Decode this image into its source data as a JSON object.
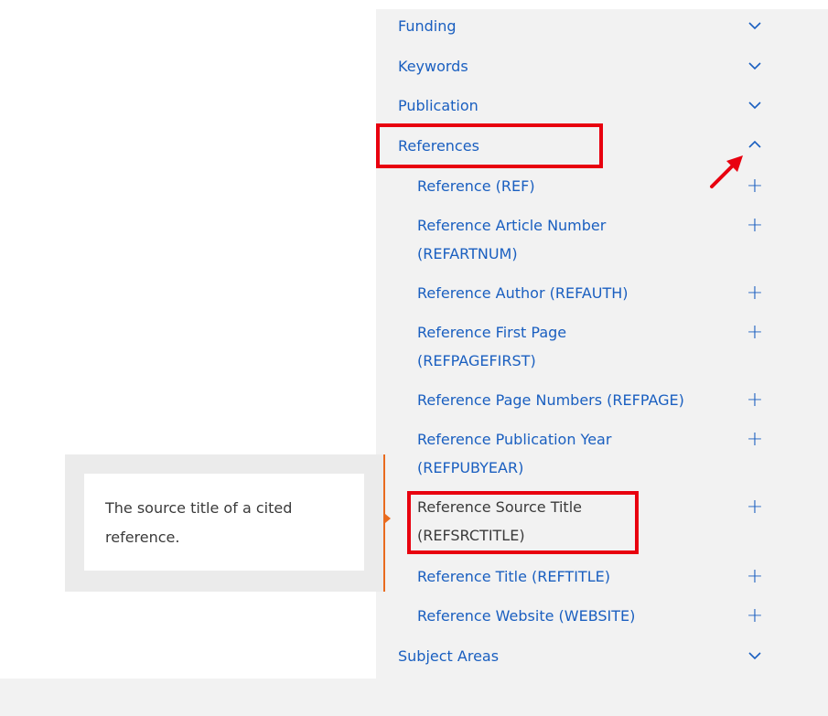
{
  "sections": [
    {
      "label": "Funding",
      "state": "collapsed"
    },
    {
      "label": "Keywords",
      "state": "collapsed"
    },
    {
      "label": "Publication",
      "state": "collapsed"
    },
    {
      "label": "References",
      "state": "expanded"
    }
  ],
  "reference_fields": [
    {
      "line1": "Reference (REF)",
      "line2": ""
    },
    {
      "line1": "Reference Article Number",
      "line2": "(REFARTNUM)"
    },
    {
      "line1": "Reference Author (REFAUTH)",
      "line2": ""
    },
    {
      "line1": "Reference First Page",
      "line2": "(REFPAGEFIRST)"
    },
    {
      "line1": "Reference Page Numbers (REFPAGE)",
      "line2": ""
    },
    {
      "line1": "Reference Publication Year",
      "line2": "(REFPUBYEAR)"
    },
    {
      "line1": "Reference Source Title",
      "line2": "(REFSRCTITLE)"
    },
    {
      "line1": "Reference Title (REFTITLE)",
      "line2": ""
    },
    {
      "line1": "Reference Website (WEBSITE)",
      "line2": ""
    }
  ],
  "last_section": {
    "label": "Subject Areas",
    "state": "collapsed"
  },
  "tooltip": {
    "line1": "The source title of a cited",
    "line2": "reference."
  },
  "icons": {
    "collapsed": "chevron-down-icon",
    "expanded": "chevron-up-icon",
    "add": "plus-icon"
  },
  "colors": {
    "link": "#1a5fc0",
    "highlight": "#e8000f",
    "tooltip_accent": "#e96b1f"
  }
}
